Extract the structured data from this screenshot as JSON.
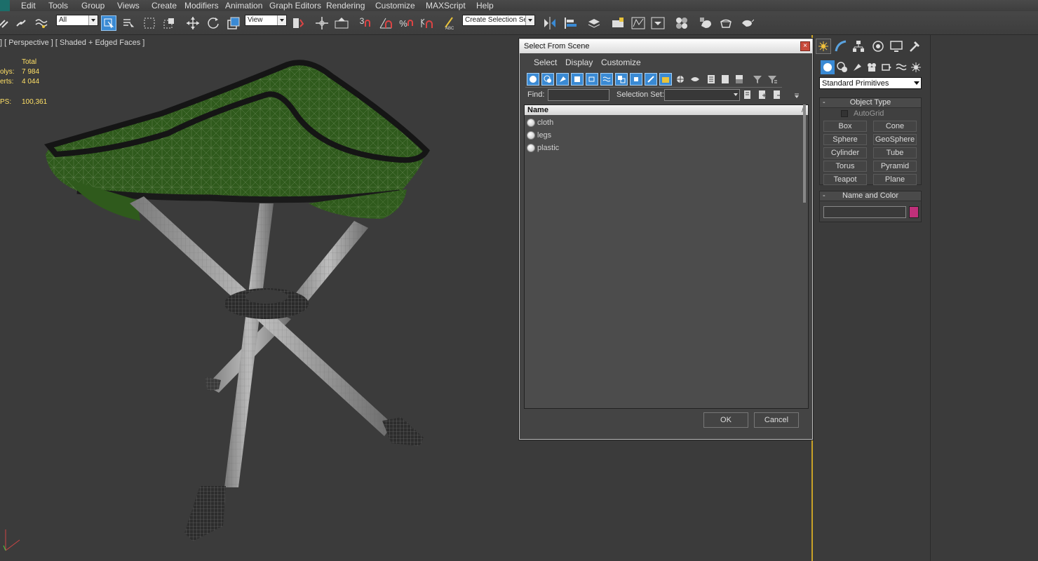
{
  "menubar": {
    "items": [
      "Edit",
      "Tools",
      "Group",
      "Views",
      "Create",
      "Modifiers",
      "Animation",
      "Graph Editors",
      "Rendering",
      "Customize",
      "MAXScript",
      "Help"
    ]
  },
  "toolbar": {
    "selection_filter": "All",
    "reference_coord": "View",
    "named_selection_placeholder": "Create Selection Se",
    "snap_number": "3"
  },
  "viewport": {
    "label": "] [ Perspective ] [ Shaded + Edged Faces ]",
    "stats": {
      "total_label": "Total",
      "polys_label": "olys:",
      "polys_value": "7 984",
      "verts_label": "erts:",
      "verts_value": "4 044",
      "fps_label": "PS:",
      "fps_value": "100,361"
    }
  },
  "dialog": {
    "title": "Select From Scene",
    "close_label": "×",
    "menus": [
      "Select",
      "Display",
      "Customize"
    ],
    "find_label": "Find:",
    "selection_set_label": "Selection Set:",
    "list_header": "Name",
    "list_sorter": "/",
    "objects": [
      "cloth",
      "legs",
      "plastic"
    ],
    "ok_label": "OK",
    "cancel_label": "Cancel"
  },
  "command_panel": {
    "category": "Standard Primitives",
    "object_type_title": "Object Type",
    "autogrid_label": "AutoGrid",
    "primitives": [
      "Box",
      "Cone",
      "Sphere",
      "GeoSphere",
      "Cylinder",
      "Tube",
      "Torus",
      "Pyramid",
      "Teapot",
      "Plane"
    ],
    "name_color_title": "Name and Color",
    "rollout_toggle": "-",
    "object_color": "#c0307a"
  },
  "colors": {
    "accent": "#3a8ad4",
    "viewport_border": "#c9a227",
    "stats_text": "#ffe066",
    "cloth_green": "#2f5a1c"
  }
}
